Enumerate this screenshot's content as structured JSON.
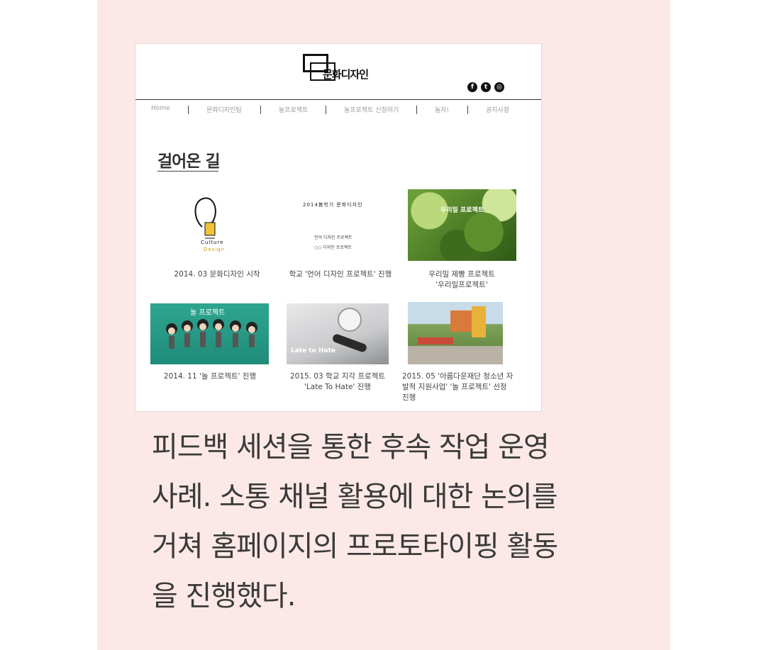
{
  "site": {
    "logo_text": "문화디자인",
    "social": [
      {
        "icon": "facebook-icon",
        "glyph": "f"
      },
      {
        "icon": "twitter-icon",
        "glyph": "t"
      },
      {
        "icon": "instagram-icon",
        "glyph": "◎"
      }
    ],
    "nav": [
      "Home",
      "문화디자인팀",
      "놀프로젝트",
      "놀프로젝트 신청하기",
      "놀자!",
      "공지사항"
    ],
    "section_title": "걸어온 길",
    "items": [
      {
        "caption": "2014. 03 문화디자인 시작",
        "img_text": [
          "Culture",
          "Design"
        ]
      },
      {
        "caption": "학교 '언어 디자인 프로젝트' 진행",
        "img_text": [
          "2014봄학기 문화디자인",
          "언어 디자인 프로젝트",
          "○○ 디자인 프로젝트"
        ]
      },
      {
        "caption_lines": [
          "우리밀 제빵 프로젝트",
          "'우리밀프로젝트'"
        ],
        "img_text": "우리밀 프로젝트"
      },
      {
        "caption": "2014. 11 '놀 프로젝트' 진행",
        "img_text": "놀 프로젝트"
      },
      {
        "caption_lines": [
          "2015. 03 학교 지각 프로젝트",
          "'Late To Hate' 진행"
        ],
        "img_text": "Late to Hate"
      },
      {
        "caption_lines": [
          "2015. 05 '아름다운재단 청소년 자",
          "발적 지원사업' '놀 프로젝트' 선정",
          "진행"
        ],
        "img_text": ""
      }
    ]
  },
  "description_lines": [
    "피드백 세션을 통한 후속 작업 운영",
    "사례. 소통 채널 활용에 대한 논의를",
    "거쳐 홈페이지의 프로토타이핑 활동",
    "을 진행했다."
  ],
  "colors": {
    "panel": "#fce9e7",
    "text": "#3a3a3a"
  }
}
